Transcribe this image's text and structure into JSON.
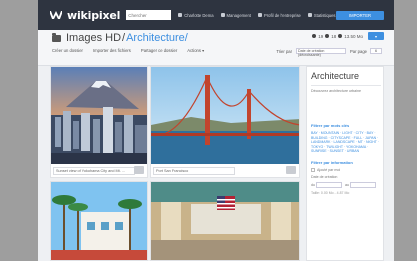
{
  "app": {
    "name": "wikipixel"
  },
  "topbar": {
    "search_placeholder": "Chercher",
    "nav": [
      {
        "label": "Charlotte Dema",
        "icon": "user-icon"
      },
      {
        "label": "Management",
        "icon": "gear-icon"
      },
      {
        "label": "Profil de l'entreprise",
        "icon": "building-icon"
      },
      {
        "label": "Statistiques",
        "icon": "chart-icon"
      }
    ],
    "import_label": "IMPORTER"
  },
  "header": {
    "root": "Images HD",
    "separator": "/",
    "category": "Architecture",
    "trailing_separator": "/",
    "count_left": "19",
    "count_right": "18",
    "size": "13.50 Mo",
    "menu_label": "▾"
  },
  "actions": [
    "Créer un dossier",
    "Importer des fichiers",
    "Partager ce dossier",
    "Actions ▾"
  ],
  "sort": {
    "label": "Trier par",
    "value": "Date de création (décroissante)",
    "perpage_label": "Par page",
    "perpage_value": "6"
  },
  "images": [
    {
      "caption": "Sunset view of Yokohama City and Mt. ..."
    },
    {
      "caption": "Port San Francisco"
    },
    {
      "caption": ""
    },
    {
      "caption": ""
    }
  ],
  "sidebar": {
    "title": "Architecture",
    "description": "Découvrez architecture urbaine",
    "keywords_title": "Filtrer par mots clés",
    "keywords": "BAY · MOUNTAIN · LIGHT · CITY · BAY · BUILDING · CITYSCAPE · FULL · JAPAN · LANDMARK · LANDSCAPE · MT · NIGHT · TOKYO · TWILIGHT · YOKOHAMA · SUNRISE · SUNSET · URBAN",
    "info_title": "Filtrer par information",
    "hide_label": "Ajouté par moi",
    "date_label": "Date de création",
    "from": "du",
    "to": "au",
    "size_note": "Taille: 0.00 Mo - 4.87 Mo"
  },
  "colors": {
    "accent": "#3d8fe0",
    "topbar": "#2e3440"
  }
}
